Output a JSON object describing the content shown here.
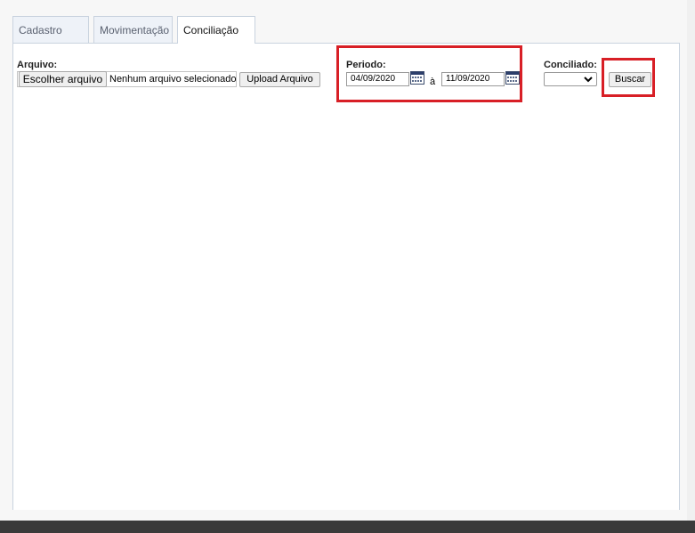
{
  "tabs": [
    {
      "label": "Cadastro"
    },
    {
      "label": "Movimentação"
    },
    {
      "label": "Conciliação"
    }
  ],
  "arquivo": {
    "label": "Arquivo:",
    "choose_label": "Escolher arquivo",
    "file_status": "Nenhum arquivo selecionado",
    "upload_label": "Upload Arquivo"
  },
  "periodo": {
    "label": "Periodo:",
    "start": "04/09/2020",
    "separator": "à",
    "end": "11/09/2020"
  },
  "conciliado": {
    "label": "Conciliado:",
    "value": ""
  },
  "buscar_label": "Buscar",
  "colors": {
    "highlight": "#d81f26",
    "tab_border": "#c9d3df",
    "bottom_bar": "#3a3a3a"
  }
}
